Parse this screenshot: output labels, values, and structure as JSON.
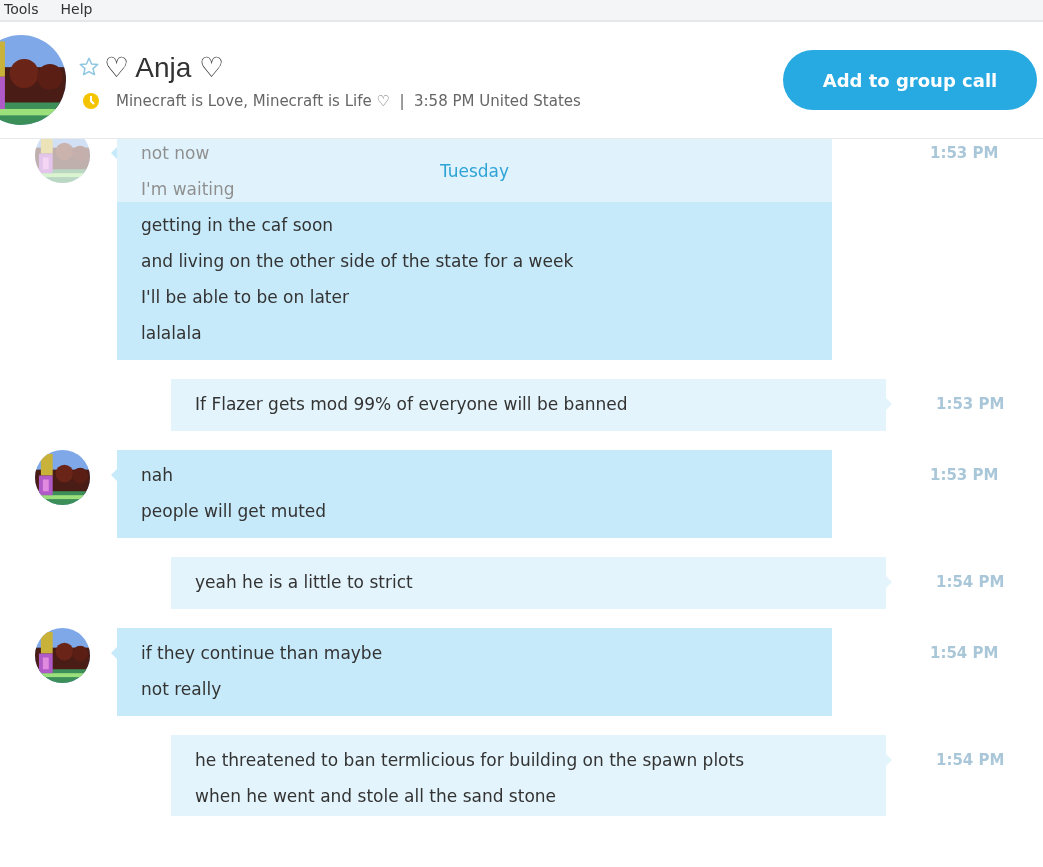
{
  "menu": [
    {
      "label": "Tools"
    },
    {
      "label": "Help"
    }
  ],
  "contact": {
    "name": "♡ Anja ♡",
    "favorite": false,
    "status": "Minecraft is Love, Minecraft is Life ♡  |  3:58 PM United States"
  },
  "call_button": "Add to group call",
  "date_divider": "Tuesday",
  "messages": [
    {
      "kind": "received",
      "lines": [
        "not now",
        "I'm waiting",
        "getting in the caf soon",
        "and living on the other side of the state for a week",
        "I'll be able to be on later",
        "lalalala"
      ],
      "time": "1:53 PM"
    },
    {
      "kind": "sent",
      "lines": [
        "If Flazer gets mod 99% of everyone will be banned"
      ],
      "time": "1:53 PM"
    },
    {
      "kind": "received",
      "lines": [
        "nah",
        "people will get muted"
      ],
      "time": "1:53 PM"
    },
    {
      "kind": "sent",
      "lines": [
        "yeah he is a little to strict"
      ],
      "time": "1:54 PM"
    },
    {
      "kind": "received",
      "lines": [
        "if they continue than maybe",
        "not really"
      ],
      "time": "1:54 PM"
    },
    {
      "kind": "sent",
      "lines": [
        "he threatened to ban termlicious for building on the spawn plots",
        "when he went and stole all the sand stone"
      ],
      "time": "1:54 PM"
    }
  ]
}
